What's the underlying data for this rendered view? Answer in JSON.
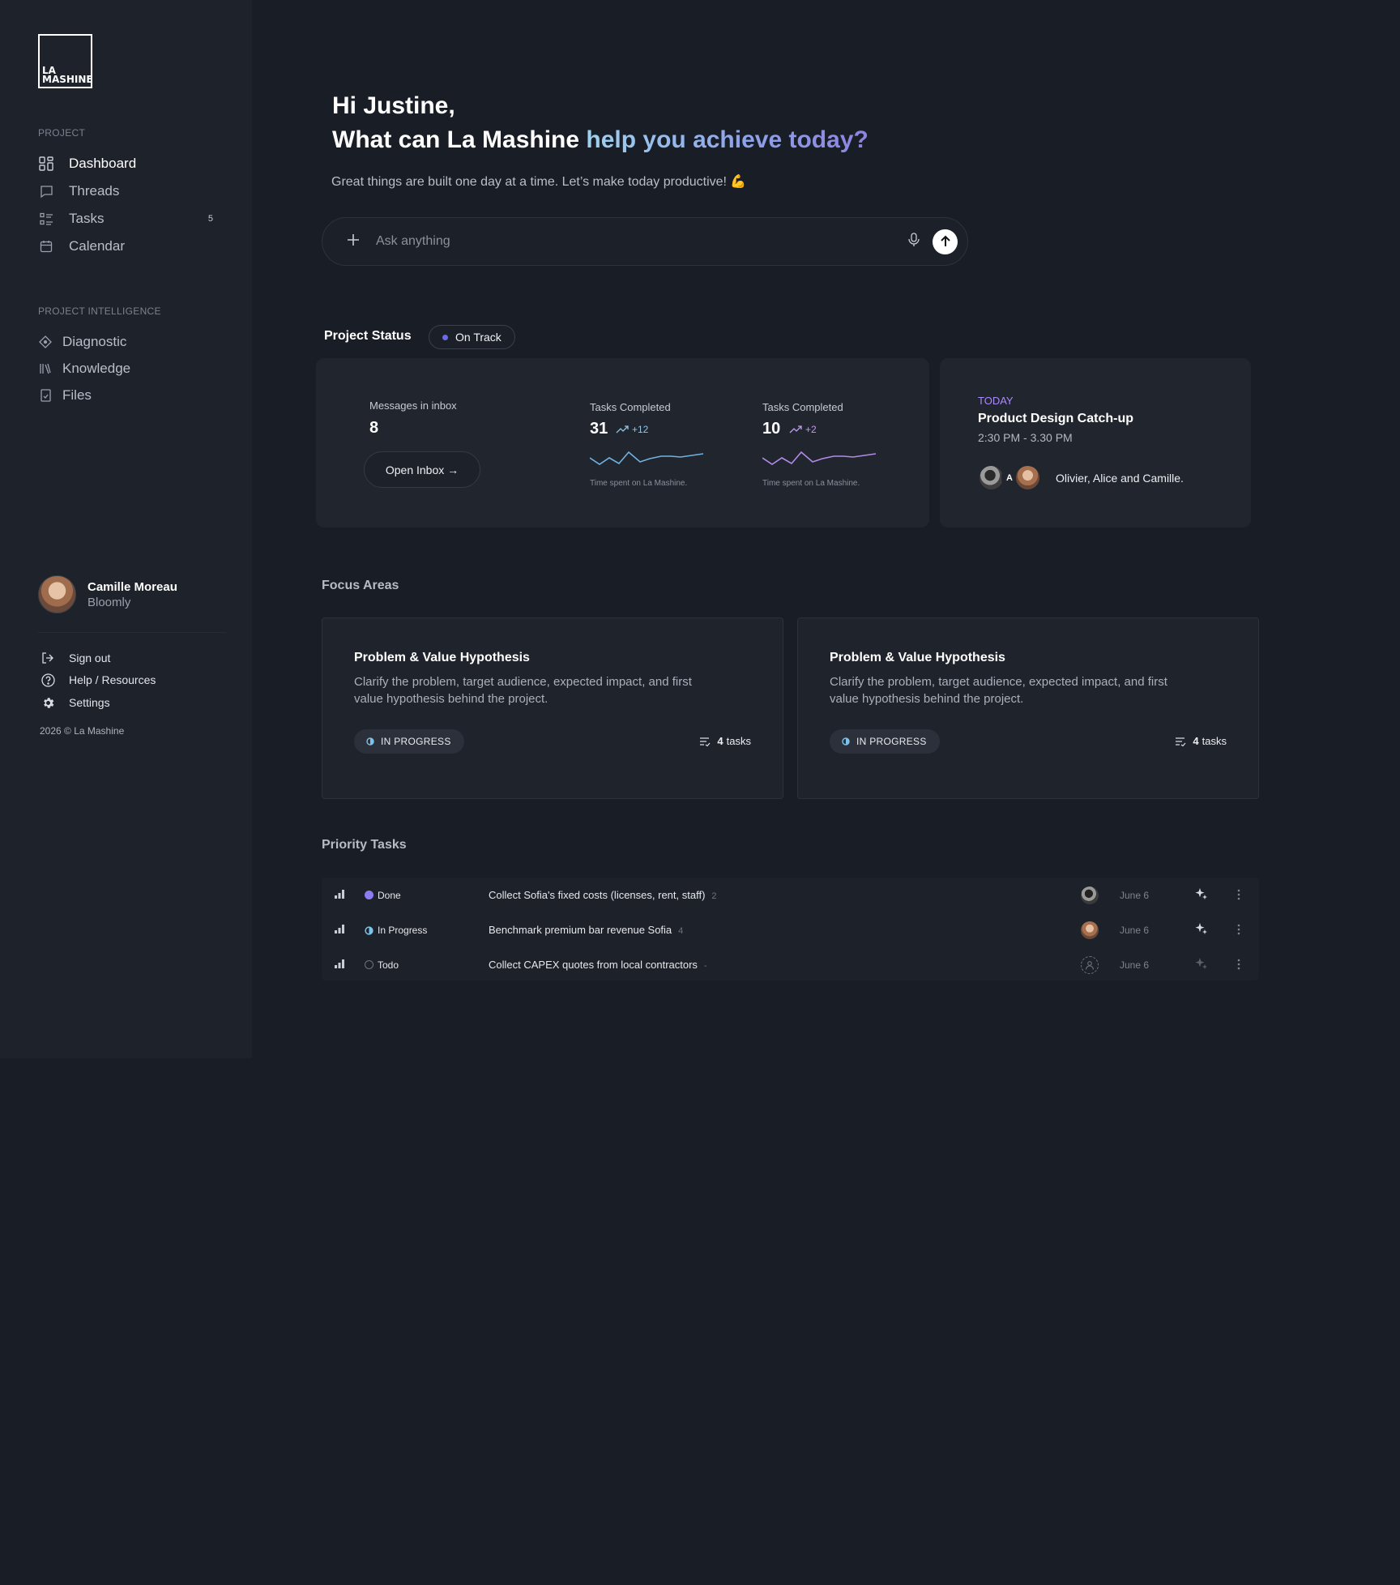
{
  "brand": {
    "logo_line1": "LA",
    "logo_line2": "MASHINE"
  },
  "sidebar": {
    "project_label": "PROJECT",
    "project_items": [
      {
        "label": "Dashboard",
        "icon": "dashboard-icon",
        "active": true
      },
      {
        "label": "Threads",
        "icon": "chat-bubble-icon"
      },
      {
        "label": "Tasks",
        "icon": "task-list-icon",
        "badge": "5"
      },
      {
        "label": "Calendar",
        "icon": "calendar-icon"
      }
    ],
    "intel_label": "PROJECT INTELLIGENCE",
    "intel_items": [
      {
        "label": "Diagnostic",
        "icon": "diamond-icon"
      },
      {
        "label": "Knowledge",
        "icon": "library-icon"
      },
      {
        "label": "Files",
        "icon": "file-icon"
      }
    ],
    "user": {
      "name": "Camille Moreau",
      "org": "Bloomly"
    },
    "footer_links": [
      {
        "label": "Sign out",
        "icon": "sign-out-icon"
      },
      {
        "label": "Help / Resources",
        "icon": "help-icon"
      },
      {
        "label": "Settings",
        "icon": "gear-icon"
      }
    ],
    "copyright": "2026 © La Mashine"
  },
  "hero": {
    "greeting": "Hi Justine,",
    "question_plain": "What can La Mashine ",
    "question_accent": "help you achieve today?",
    "subline": "Great things are built one day at a time. Let’s make today productive! 💪",
    "ask_placeholder": "Ask anything"
  },
  "status": {
    "title": "Project Status",
    "badge": "On Track",
    "inbox_label": "Messages in inbox",
    "inbox_count": "8",
    "open_inbox": "Open Inbox →",
    "metrics": [
      {
        "label": "Tasks Completed",
        "value": "31",
        "delta": "+12",
        "caption": "Time spent on La Mashine.",
        "color": "#6fb3e0"
      },
      {
        "label": "Tasks Completed",
        "value": "10",
        "delta": "+2",
        "caption": "Time spent on La Mashine.",
        "color": "#b48ae8"
      }
    ],
    "event": {
      "day": "TODAY",
      "title": "Product Design Catch-up",
      "time": "2:30 PM - 3.30 PM",
      "avatar_initial": "A",
      "attendees": "Olivier, Alice and Camille."
    }
  },
  "focus": {
    "title": "Focus Areas",
    "cards": [
      {
        "title": "Problem & Value Hypothesis",
        "desc": "Clarify the problem, target audience, expected impact, and first value hypothesis behind the project.",
        "status": "IN PROGRESS",
        "count": "4",
        "count_label": "tasks"
      },
      {
        "title": "Problem & Value Hypothesis",
        "desc": "Clarify the problem, target audience, expected impact, and first value hypothesis behind the project.",
        "status": "IN PROGRESS",
        "count": "4",
        "count_label": "tasks"
      }
    ]
  },
  "priority": {
    "title": "Priority Tasks",
    "rows": [
      {
        "status": "Done",
        "title": "Collect Sofia's fixed costs (licenses, rent, staff)",
        "count": "2",
        "date": "June 6"
      },
      {
        "status": "In Progress",
        "title": "Benchmark premium bar revenue Sofia",
        "count": "4",
        "date": "June 6"
      },
      {
        "status": "Todo",
        "title": "Collect CAPEX quotes from local contractors",
        "count": "-",
        "date": "June 6"
      }
    ]
  }
}
